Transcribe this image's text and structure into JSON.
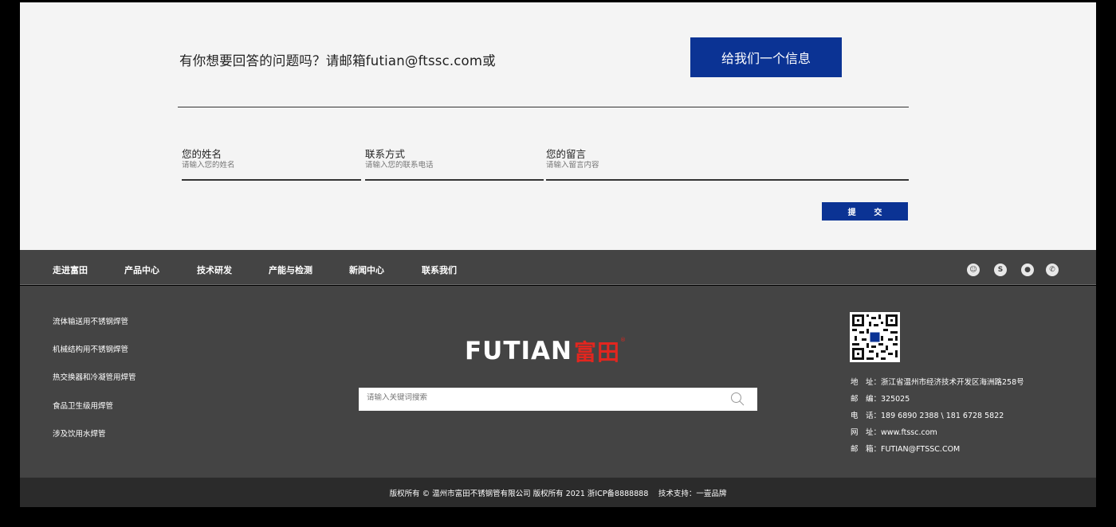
{
  "contact": {
    "question": "有你想要回答的问题吗？请邮箱futian@ftssc.com或",
    "message_button": "给我们一个信息",
    "fields": [
      {
        "label": "您的姓名",
        "placeholder": "请输入您的姓名"
      },
      {
        "label": "联系方式",
        "placeholder": "请输入您的联系电话"
      },
      {
        "label": "您的留言",
        "placeholder": "请输入留言内容"
      }
    ],
    "submit": "提 交"
  },
  "nav": {
    "items": [
      "走进富田",
      "产品中心",
      "技术研发",
      "产能与检测",
      "新闻中心",
      "联系我们"
    ],
    "social": [
      {
        "icon": "qq-icon",
        "glyph": "☺"
      },
      {
        "icon": "skype-icon",
        "glyph": "S"
      },
      {
        "icon": "wechat-icon",
        "glyph": "●"
      },
      {
        "icon": "phone-icon",
        "glyph": "✆"
      }
    ]
  },
  "footer": {
    "products": [
      "流体输送用不锈钢焊管",
      "机械结构用不锈钢焊管",
      "热交换器和冷凝管用焊管",
      "食品卫生级用焊管",
      "涉及饮用水焊管"
    ],
    "logo_text": "FUTIAN",
    "logo_cn": "富田",
    "logo_reg": "®",
    "search_placeholder": "请输入关键词搜索",
    "info": [
      {
        "key": "地　址：",
        "value": "浙江省温州市经济技术开发区海洲路258号"
      },
      {
        "key": "邮　编：",
        "value": "325025"
      },
      {
        "key": "电　话：",
        "value": "189 6890 2388 \\ 181 6728 5822"
      },
      {
        "key": "网　址：",
        "value": "www.ftssc.com"
      },
      {
        "key": "邮　箱：",
        "value": "FUTIAN@FTSSC.COM"
      }
    ],
    "copyright": "版权所有 © 温州市富田不锈钢管有限公司 版权所有 2021 浙ICP备8888888　 技术支持：一壹品牌"
  },
  "colors": {
    "brand_blue": "#0b3394",
    "logo_red": "#e2261f",
    "footer_bg": "#444444"
  }
}
